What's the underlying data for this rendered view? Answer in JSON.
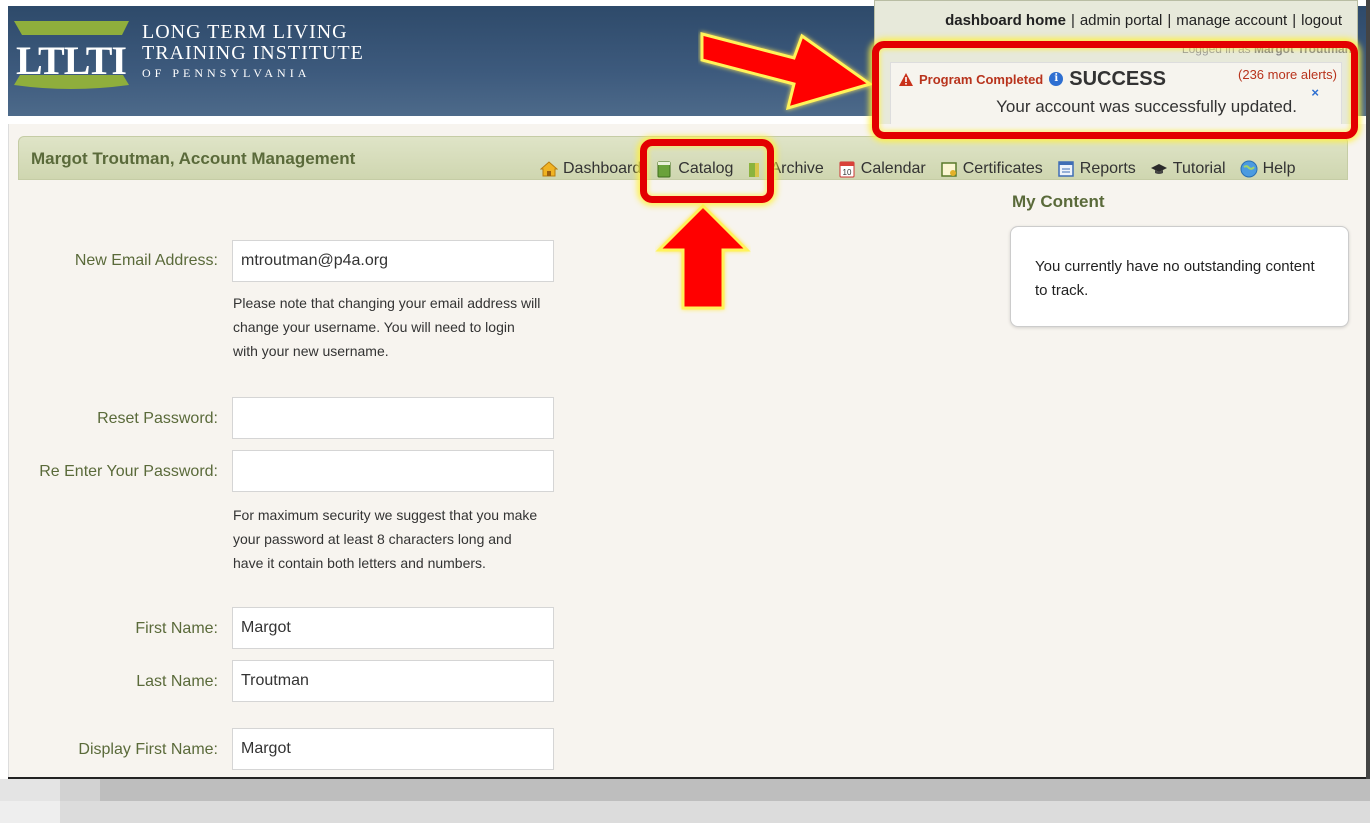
{
  "header": {
    "logo_text": "LTLTI",
    "org_line1": "LONG TERM LIVING",
    "org_line2": "TRAINING INSTITUTE",
    "org_line3": "OF PENNSYLVANIA",
    "brand_colors": {
      "logo_green": "#8fae3c",
      "header_blue": "#3d5a7d"
    }
  },
  "toplinks": {
    "dashboard_home": "dashboard home",
    "admin_portal": "admin portal",
    "manage_account": "manage account",
    "logout": "logout",
    "separator": "|"
  },
  "user": {
    "logged_in_prefix": "Logged in as",
    "name": "Margot Troutman"
  },
  "alert": {
    "warning_label": "Program Completed",
    "info_glyph": "i",
    "status": "SUCCESS",
    "more_alerts": "(236 more alerts)",
    "close_glyph": "×",
    "message": "Your account was successfully updated."
  },
  "page": {
    "title": "Margot Troutman, Account Management"
  },
  "nav": {
    "dashboard": "Dashboard",
    "catalog": "Catalog",
    "archive": "Archive",
    "calendar": "Calendar",
    "calendar_day": "10",
    "certificates": "Certificates",
    "reports": "Reports",
    "tutorial": "Tutorial",
    "help": "Help"
  },
  "form": {
    "email_label": "New Email Address:",
    "email_value": "mtroutman@p4a.org",
    "email_help": "Please note that changing your email address will change your username. You will need to login with your new username.",
    "reset_password_label": "Reset Password:",
    "reenter_password_label": "Re Enter Your Password:",
    "password_help": "For maximum security we suggest that you make your password at least 8 characters long and have it contain both letters and numbers.",
    "first_name_label": "First Name:",
    "first_name_value": "Margot",
    "last_name_label": "Last Name:",
    "last_name_value": "Troutman",
    "display_first_name_label": "Display First Name:",
    "display_first_name_value": "Margot"
  },
  "my_content": {
    "title": "My Content",
    "message": "You currently have no outstanding content to track."
  },
  "annotation_colors": {
    "highlight_red": "#e30000",
    "glow_yellow": "#fff03c"
  }
}
